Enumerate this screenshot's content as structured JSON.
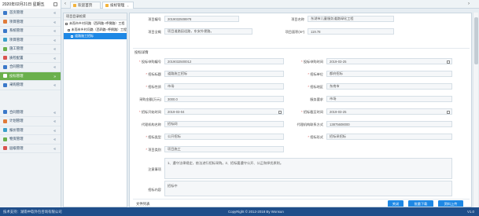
{
  "topbar": {
    "date": "2020年02月21日 星期五",
    "tabs": [
      {
        "label": "欢迎首页"
      },
      {
        "label": "投标管理"
      }
    ]
  },
  "sidebar": {
    "items": [
      {
        "label": "首页管理",
        "color": "#3a78c9"
      },
      {
        "label": "项目管理",
        "color": "#e07b39"
      },
      {
        "label": "系统管理",
        "color": "#3a78c9"
      },
      {
        "label": "项目管理",
        "color": "#3aa0c9"
      },
      {
        "label": "施工管理",
        "color": "#6ab04c"
      },
      {
        "label": "质检配置",
        "color": "#d9534f"
      },
      {
        "label": "合同管理",
        "color": "#3a78c9"
      },
      {
        "label": "投标管理",
        "color": "#6ab04c",
        "active": true
      },
      {
        "label": "采购管理",
        "color": "#3a78c9"
      }
    ],
    "items2": [
      {
        "label": "合同管理",
        "color": "#3a78c9"
      },
      {
        "label": "计划管理",
        "color": "#e07b39"
      },
      {
        "label": "报价管理",
        "color": "#3aa0c9"
      },
      {
        "label": "物资管理",
        "color": "#6ab04c"
      },
      {
        "label": "层级管理",
        "color": "#d9534f"
      }
    ]
  },
  "tree": {
    "title": "项目目录检索",
    "nodes": [
      {
        "label": "未而市乡村问路（西四路~呼倒路）工程"
      },
      {
        "label": "未而市乡村问路（西四路~呼倒路）工程"
      },
      {
        "label": "道路施工招标",
        "selected": true
      }
    ]
  },
  "project": {
    "code_label": "项目编号",
    "code": "2019032508978",
    "name_label": "项目名称",
    "name": "东湖市儿童服务道路绿化工程",
    "overview_label": "项目全概",
    "overview": "项目道路因适路，东安外便路。",
    "area_label": "项目面积(m²)",
    "area": "119.78"
  },
  "tender": {
    "section": "投标详情",
    "fields": {
      "tender_no_label": "投标申购编号",
      "tender_no": "2019032500012",
      "tender_date_label": "投标申购时间",
      "tender_date": "2019-03-25",
      "title_label": "招标标题",
      "title": "道路施工招标",
      "bidder_label": "招标单位",
      "bidder": "都府招标",
      "type_label": "招标性质",
      "type": "市场",
      "region_label": "招标地区",
      "region": "东南市",
      "budget_label": "采购金额(万元)",
      "budget": "3000.0",
      "req_label": "服务要求",
      "req": "市场",
      "start_label": "招标开始时间",
      "start": "2019-03-04",
      "end_label": "招标截至时间",
      "end": "2019-03-25",
      "agent_label": "代理机构名称",
      "agent": "招标网",
      "agent_phone_label": "代理机构联系方式",
      "agent_phone": "13875608000",
      "method_label": "招标类型",
      "method": "公开招标",
      "form_label": "招标形式",
      "form": "招标采招标",
      "class_label": "项目类别",
      "class": "项目施工",
      "notes_label": "注意事项",
      "notes": "1、遵守法律规定，依法进行招标采购。2、招标要遵守公开、公正和择优原则。",
      "content_label": "招标内容",
      "content": "招标中"
    }
  },
  "files": {
    "label": "文件列表",
    "buttons": {
      "back": "关闭",
      "upload": "批量下载",
      "download": "资料上传"
    }
  },
  "footer": {
    "support": "技术支持：湖南中软外包咨询有限公司",
    "copyright": "CopyRight © 2012-2018 By Wonsun",
    "version": "V1.0"
  }
}
